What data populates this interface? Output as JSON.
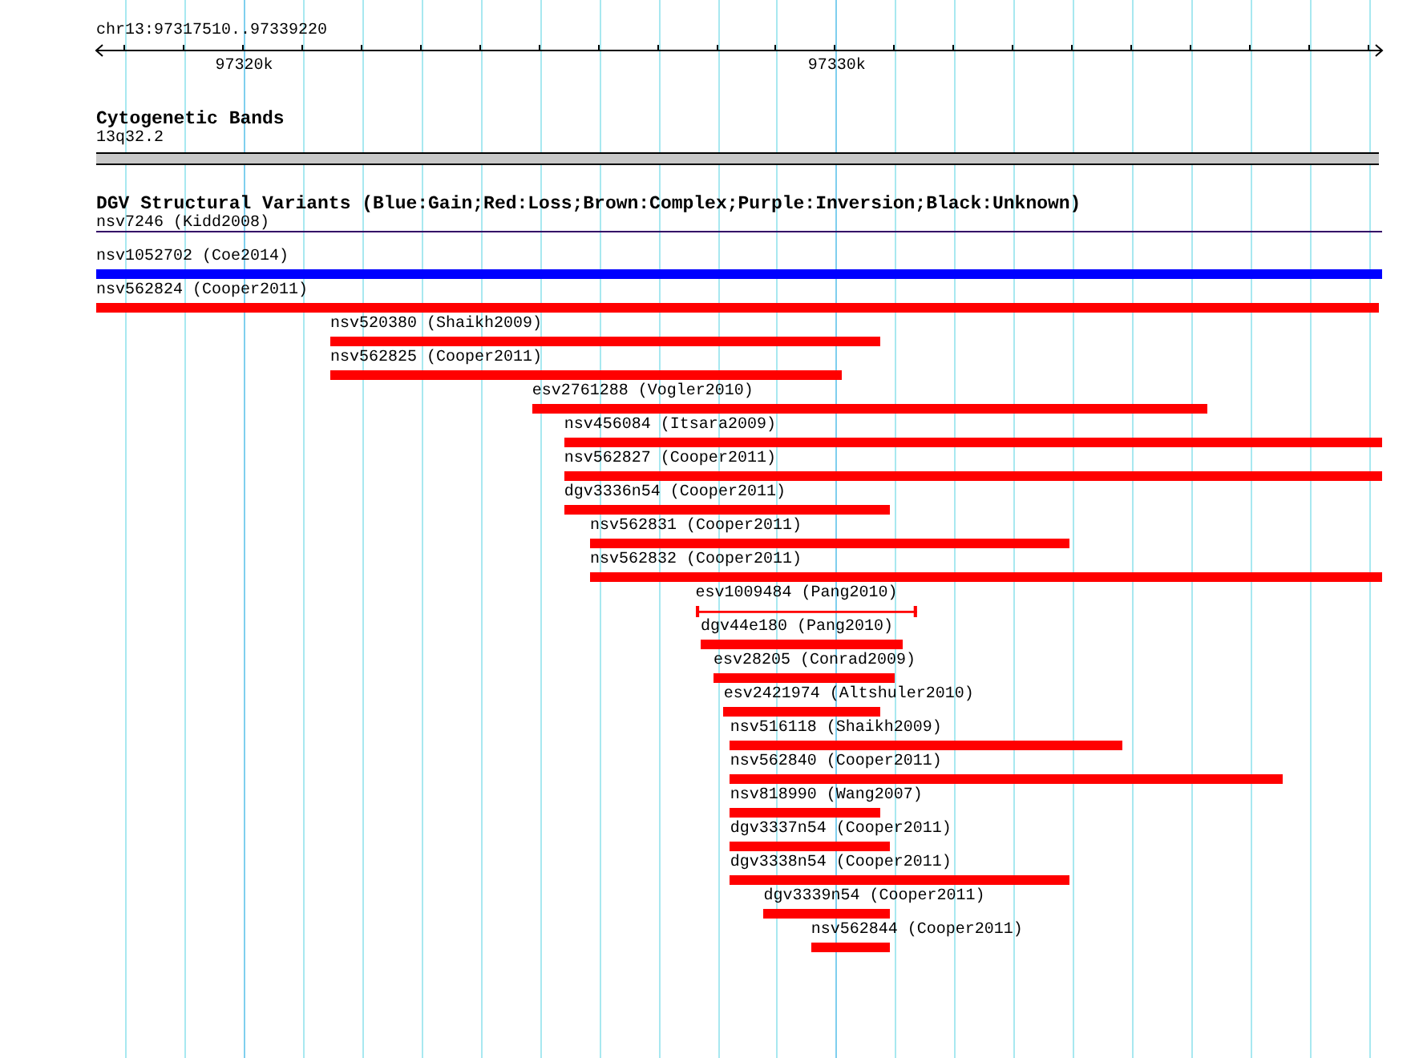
{
  "ruler": {
    "range": "chr13:97317510..97339220",
    "labels": [
      "97320k",
      "97330k"
    ]
  },
  "cytoband_track": {
    "title": "Cytogenetic Bands",
    "band": "13q32.2"
  },
  "dgv_track": {
    "title": "DGV Structural Variants (Blue:Gain;Red:Loss;Brown:Complex;Purple:Inversion;Black:Unknown)",
    "features": [
      {
        "label": "nsv7246 (Kidd2008)",
        "kind": "thin",
        "color": "#330066"
      },
      {
        "label": "nsv1052702 (Coe2014)",
        "kind": "bar",
        "color": "#0000ff"
      },
      {
        "label": "nsv562824 (Cooper2011)",
        "kind": "bar",
        "color": "#ff0000"
      },
      {
        "label": "nsv520380 (Shaikh2009)",
        "kind": "bar",
        "color": "#ff0000"
      },
      {
        "label": "nsv562825 (Cooper2011)",
        "kind": "bar",
        "color": "#ff0000"
      },
      {
        "label": "esv2761288 (Vogler2010)",
        "kind": "bar",
        "color": "#ff0000"
      },
      {
        "label": "nsv456084 (Itsara2009)",
        "kind": "bar",
        "color": "#ff0000"
      },
      {
        "label": "nsv562827 (Cooper2011)",
        "kind": "bar",
        "color": "#ff0000"
      },
      {
        "label": "dgv3336n54 (Cooper2011)",
        "kind": "bar",
        "color": "#ff0000"
      },
      {
        "label": "nsv562831 (Cooper2011)",
        "kind": "bar",
        "color": "#ff0000"
      },
      {
        "label": "nsv562832 (Cooper2011)",
        "kind": "bar",
        "color": "#ff0000"
      },
      {
        "label": "esv1009484 (Pang2010)",
        "kind": "span",
        "color": "#ff0000"
      },
      {
        "label": "dgv44e180 (Pang2010)",
        "kind": "bar",
        "color": "#ff0000"
      },
      {
        "label": "esv28205 (Conrad2009)",
        "kind": "bar",
        "color": "#ff0000"
      },
      {
        "label": "esv2421974 (Altshuler2010)",
        "kind": "bar",
        "color": "#ff0000"
      },
      {
        "label": "nsv516118 (Shaikh2009)",
        "kind": "bar",
        "color": "#ff0000"
      },
      {
        "label": "nsv562840 (Cooper2011)",
        "kind": "bar",
        "color": "#ff0000"
      },
      {
        "label": "nsv818990 (Wang2007)",
        "kind": "bar",
        "color": "#ff0000"
      },
      {
        "label": "dgv3337n54 (Cooper2011)",
        "kind": "bar",
        "color": "#ff0000"
      },
      {
        "label": "dgv3338n54 (Cooper2011)",
        "kind": "bar",
        "color": "#ff0000"
      },
      {
        "label": "dgv3339n54 (Cooper2011)",
        "kind": "bar",
        "color": "#ff0000"
      },
      {
        "label": "nsv562844 (Cooper2011)",
        "kind": "bar",
        "color": "#ff0000"
      }
    ]
  }
}
